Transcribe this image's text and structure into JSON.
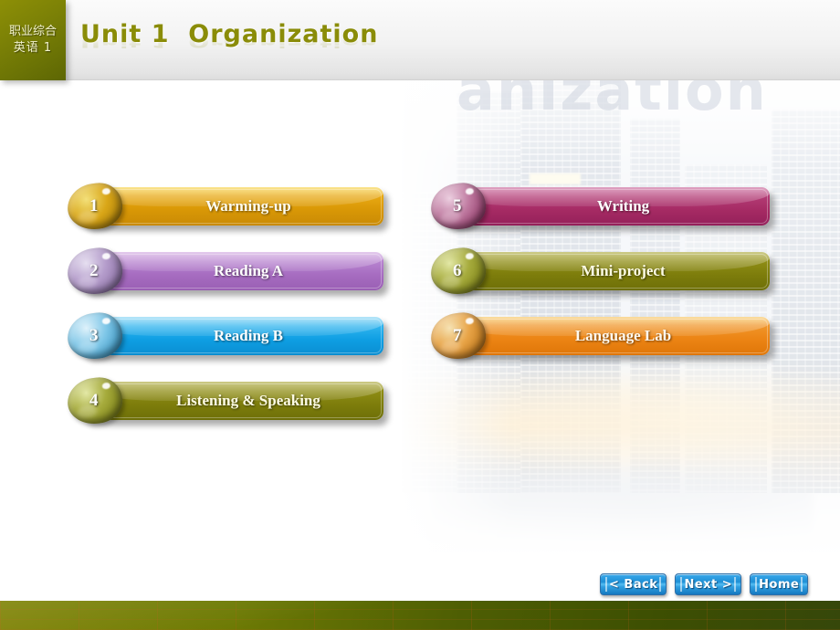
{
  "header": {
    "logo_line1": "职业综合",
    "logo_line2": "英语 1",
    "title": "Unit 1  Organization",
    "ghost_word": "anization",
    "accent_color": "#8a8c08",
    "logo_bg_color": "#7d8206"
  },
  "menu": {
    "left_column": [
      {
        "number": "1",
        "label": "Warming-up",
        "color": "#d99806"
      },
      {
        "number": "2",
        "label": "Reading A",
        "color": "#a66cc0"
      },
      {
        "number": "3",
        "label": "Reading B",
        "color": "#0e9ee3"
      },
      {
        "number": "4",
        "label": "Listening & Speaking",
        "color": "#7c7c0b"
      }
    ],
    "right_column": [
      {
        "number": "5",
        "label": "Writing",
        "color": "#a52a63"
      },
      {
        "number": "6",
        "label": "Mini-project",
        "color": "#7c7c0b"
      },
      {
        "number": "7",
        "label": "Language Lab",
        "color": "#ec8414"
      }
    ]
  },
  "nav": {
    "back": "< Back",
    "next": "Next >",
    "home": "Home",
    "color": "#1e8fd6"
  },
  "footer": {
    "color": "#5a6a03"
  }
}
